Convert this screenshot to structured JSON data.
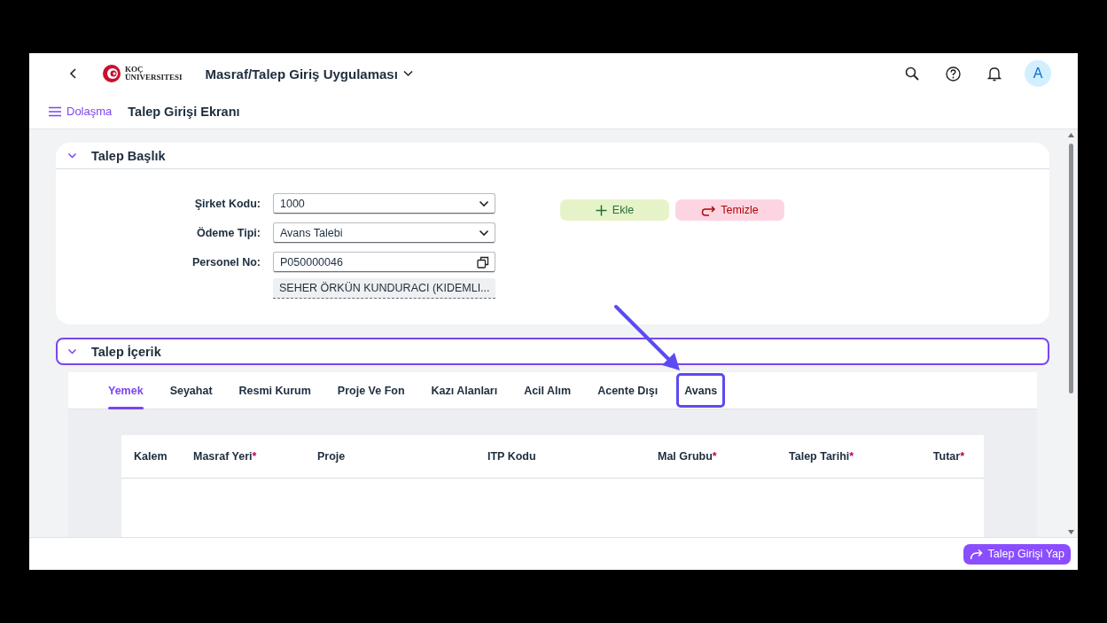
{
  "app": {
    "logo_text": [
      "KOÇ",
      "ÜNIVERSITESI"
    ],
    "title": "Masraf/Talep Giriş Uygulaması",
    "avatar": "A"
  },
  "nav": {
    "menu_label": "Dolaşma",
    "page_title": "Talep Girişi Ekranı"
  },
  "header_panel": {
    "title": "Talep Başlık",
    "expanded": true,
    "fields": [
      {
        "kind": "select",
        "label": "Şirket Kodu:",
        "value": "1000"
      },
      {
        "kind": "select",
        "label": "Ödeme Tipi:",
        "value": "Avans Talebi"
      },
      {
        "kind": "copy",
        "label": "Personel No:",
        "value": "P050000046",
        "description": "SEHER ÖRKÜN KUNDURACI (KIDEMLI..."
      }
    ],
    "buttons": [
      {
        "kind": "add",
        "label": "Ekle"
      },
      {
        "kind": "clear",
        "label": "Temizle"
      }
    ]
  },
  "content_panel": {
    "title": "Talep İçerik",
    "expanded": true,
    "tabs": [
      {
        "label": "Yemek",
        "selected": true,
        "highlighted": false
      },
      {
        "label": "Seyahat",
        "selected": false,
        "highlighted": false
      },
      {
        "label": "Resmi Kurum",
        "selected": false,
        "highlighted": false
      },
      {
        "label": "Proje Ve Fon",
        "selected": false,
        "highlighted": false
      },
      {
        "label": "Kazı Alanları",
        "selected": false,
        "highlighted": false
      },
      {
        "label": "Acil Alım",
        "selected": false,
        "highlighted": false
      },
      {
        "label": "Acente Dışı",
        "selected": false,
        "highlighted": false
      },
      {
        "label": "Avans",
        "selected": false,
        "highlighted": true
      }
    ],
    "table": {
      "columns": [
        {
          "label": "Kalem"
        },
        {
          "label": "Masraf Yeri",
          "mark": "*"
        },
        {
          "label": "Proje"
        },
        {
          "label": "ITP Kodu"
        },
        {
          "label": "Mal Grubu",
          "mark": "*"
        },
        {
          "label": "Talep Tarihi",
          "mark": "*"
        },
        {
          "label": "Tutar",
          "mark": "*"
        }
      ]
    }
  },
  "footer": {
    "buttons": [
      {
        "kind": "forward",
        "label": "Talep Girişi Yap"
      }
    ]
  }
}
